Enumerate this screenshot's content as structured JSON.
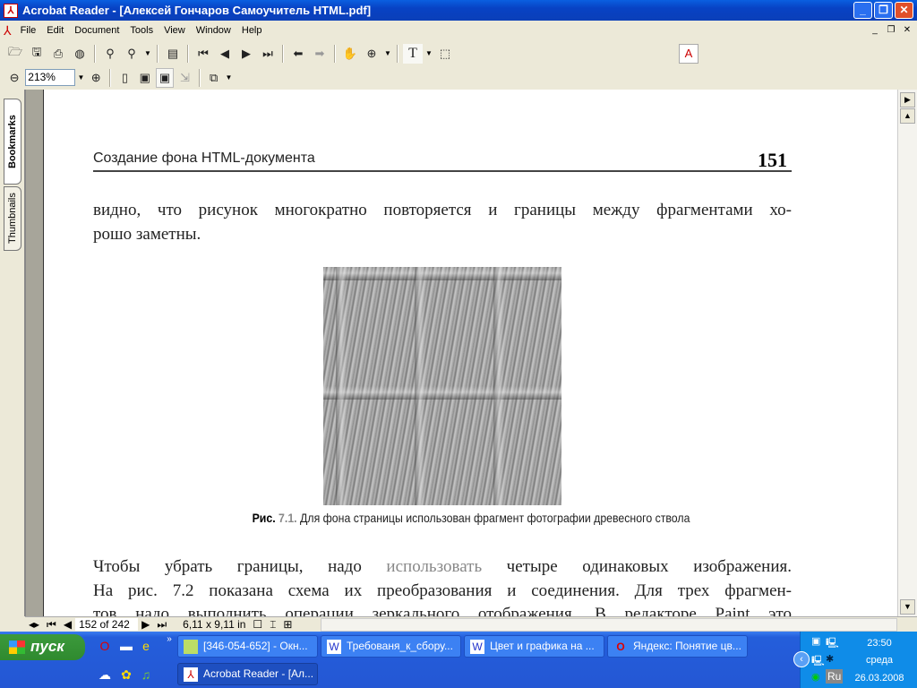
{
  "window": {
    "title": "Acrobat Reader - [Алексей Гончаров Самоучитель HTML.pdf]",
    "min": "_",
    "max": "❐",
    "close": "✕"
  },
  "menu": {
    "items": [
      "File",
      "Edit",
      "Document",
      "Tools",
      "View",
      "Window",
      "Help"
    ],
    "doc_min": "_",
    "doc_restore": "❐",
    "doc_close": "✕"
  },
  "toolbar": {
    "zoom": "213%"
  },
  "navpane": {
    "tabs": [
      "Bookmarks",
      "Thumbnails"
    ]
  },
  "page": {
    "running_head": "Создание фона HTML-документа",
    "page_number": "151",
    "lines_top": [
      "видно, что рисунок многократно повторяется и границы между фрагментами хо-",
      "рошо заметны."
    ],
    "caption_label": "Рис.",
    "caption_num": "7.1.",
    "caption_text": "Для фона страницы использован фрагмент фотографии древесного ствола",
    "para_1a": "Чтобы убрать границы, надо ",
    "para_1b": "использовать",
    "para_1c": " четыре одинаковых изображения.",
    "para_2": "На рис. 7.2 показана схема их преобразования и соединения. Для трех фрагмен-",
    "para_3": "тов надо выполнить операции зеркального отображения. В редакторе Paint это"
  },
  "status": {
    "page": "152 of 242",
    "size": "6,11 x 9,11 in"
  },
  "taskbar": {
    "start": "пуск",
    "tasks": [
      "[346-054-652] - Окн...",
      "Требованя_к_сбору...",
      "Цвет и графика на ...",
      "Яндекс: Понятие цв...",
      "Acrobat Reader - [Ал..."
    ],
    "clock": {
      "time": "23:50",
      "day": "среда",
      "date": "26.03.2008"
    },
    "lang": "Ru"
  }
}
